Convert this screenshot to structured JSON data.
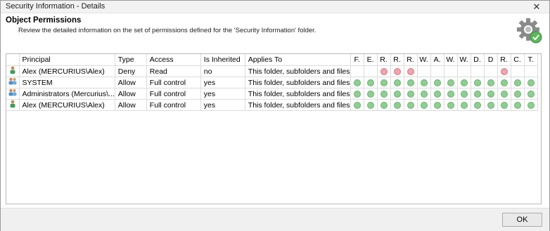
{
  "window": {
    "title": "Security Information - Details",
    "close_glyph": "✕"
  },
  "header": {
    "title": "Object Permissions",
    "description": "Review the detailed information on the set of permissions defined for the 'Security Information' folder."
  },
  "table": {
    "columns": [
      "",
      "Principal",
      "Type",
      "Access",
      "Is Inherited",
      "Applies To"
    ],
    "perm_columns": [
      "F.",
      "E.",
      "R.",
      "R.",
      "R.",
      "W.",
      "A.",
      "W.",
      "W.",
      "D.",
      "D",
      "R.",
      "C.",
      "T."
    ],
    "rows": [
      {
        "icon": "user-icon",
        "principal": "Alex (MERCURIUS\\Alex)",
        "type": "Deny",
        "access": "Read",
        "inherited": "no",
        "applies_to": "This folder, subfolders and files",
        "perms": [
          "",
          "",
          "deny",
          "deny",
          "deny",
          "",
          "",
          "",
          "",
          "",
          "",
          "deny",
          "",
          ""
        ]
      },
      {
        "icon": "group-icon",
        "principal": "SYSTEM",
        "type": "Allow",
        "access": "Full control",
        "inherited": "yes",
        "applies_to": "This folder, subfolders and files",
        "perms": [
          "allow",
          "allow",
          "allow",
          "allow",
          "allow",
          "allow",
          "allow",
          "allow",
          "allow",
          "allow",
          "allow",
          "allow",
          "allow",
          "allow"
        ]
      },
      {
        "icon": "group-icon",
        "principal": "Administrators (Mercurius\\...",
        "type": "Allow",
        "access": "Full control",
        "inherited": "yes",
        "applies_to": "This folder, subfolders and files",
        "perms": [
          "allow",
          "allow",
          "allow",
          "allow",
          "allow",
          "allow",
          "allow",
          "allow",
          "allow",
          "allow",
          "allow",
          "allow",
          "allow",
          "allow"
        ]
      },
      {
        "icon": "user-icon",
        "principal": "Alex (MERCURIUS\\Alex)",
        "type": "Allow",
        "access": "Full control",
        "inherited": "yes",
        "applies_to": "This folder, subfolders and files",
        "perms": [
          "allow",
          "allow",
          "allow",
          "allow",
          "allow",
          "allow",
          "allow",
          "allow",
          "allow",
          "allow",
          "allow",
          "allow",
          "allow",
          "allow"
        ]
      }
    ]
  },
  "footer": {
    "ok_label": "OK"
  },
  "colors": {
    "allow": "#8fce93",
    "deny": "#f2a3ab"
  }
}
